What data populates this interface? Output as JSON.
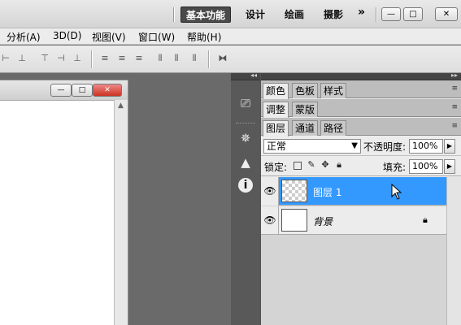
{
  "workspaces": [
    "基本功能",
    "设计",
    "绘画",
    "摄影"
  ],
  "more_label": "»",
  "window_buttons": {
    "minimize": "—",
    "maximize": "□",
    "close": "✕"
  },
  "menus": [
    "分析(A)",
    "3D(D)",
    "视图(V)",
    "窗口(W)",
    "帮助(H)"
  ],
  "document": {
    "minimize": "—",
    "maximize": "□",
    "close": "✕"
  },
  "panel_groups": [
    {
      "tabs": [
        "颜色",
        "色板",
        "样式"
      ]
    },
    {
      "tabs": [
        "调整",
        "蒙版"
      ]
    },
    {
      "tabs": [
        "图层",
        "通道",
        "路径"
      ]
    }
  ],
  "panel_menu_glyph": "≡",
  "layers_panel": {
    "blend_mode": "正常",
    "opacity_label": "不透明度:",
    "opacity_value": "100%",
    "lock_label": "锁定:",
    "fill_label": "填充:",
    "fill_value": "100%",
    "layers": [
      {
        "name": "图层 1",
        "selected": true,
        "transparent": true
      },
      {
        "name": "背景",
        "selected": false,
        "locked": true
      }
    ]
  },
  "colors": {
    "selected_layer": "#3399ff",
    "dock_bg": "#535353",
    "active_workspace": "#4a4a4a"
  }
}
